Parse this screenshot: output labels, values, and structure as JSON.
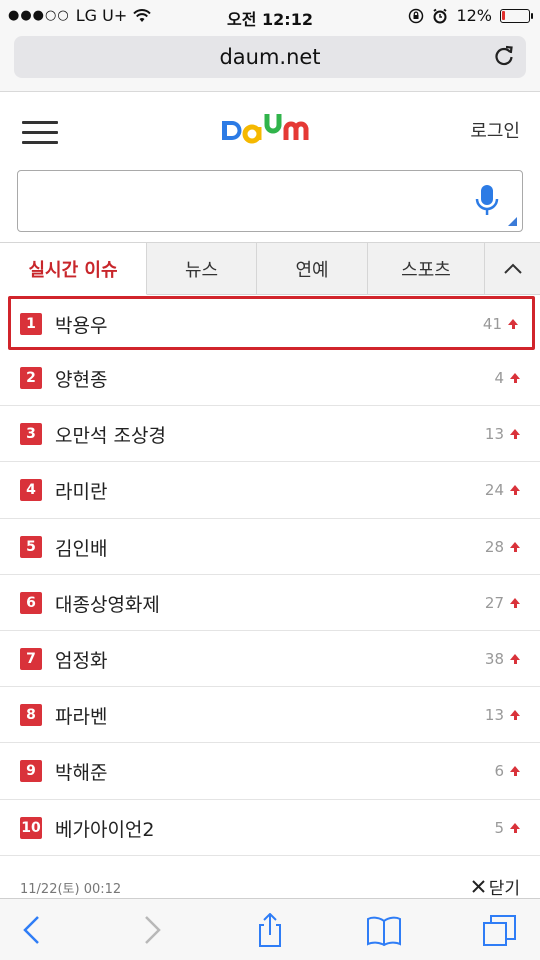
{
  "status_bar": {
    "signal": "●●●○○",
    "carrier": "LG U+",
    "time": "오전 12:12",
    "battery": "12%",
    "battery_level": 0.12,
    "battery_color": "#e0302e"
  },
  "browser": {
    "url": "daum.net"
  },
  "header": {
    "login_label": "로그인"
  },
  "search": {
    "value": "",
    "placeholder": ""
  },
  "tabs": [
    {
      "label": "실시간 이슈",
      "active": true
    },
    {
      "label": "뉴스"
    },
    {
      "label": "연예"
    },
    {
      "label": "스포츠"
    }
  ],
  "trending": [
    {
      "rank": "1",
      "keyword": "박용우",
      "change": "41"
    },
    {
      "rank": "2",
      "keyword": "양현종",
      "change": "4"
    },
    {
      "rank": "3",
      "keyword": "오만석 조상경",
      "change": "13"
    },
    {
      "rank": "4",
      "keyword": "라미란",
      "change": "24"
    },
    {
      "rank": "5",
      "keyword": "김인배",
      "change": "28"
    },
    {
      "rank": "6",
      "keyword": "대종상영화제",
      "change": "27"
    },
    {
      "rank": "7",
      "keyword": "엄정화",
      "change": "38"
    },
    {
      "rank": "8",
      "keyword": "파라벤",
      "change": "13"
    },
    {
      "rank": "9",
      "keyword": "박해준",
      "change": "6"
    },
    {
      "rank": "10",
      "keyword": "베가아이언2",
      "change": "5"
    }
  ],
  "footer": {
    "timestamp": "11/22(토) 00:12",
    "close_label": "닫기"
  },
  "colors": {
    "accent": "#d9323a",
    "link_blue": "#3b7bd8",
    "daum_blue": "#2c7be5",
    "daum_yellow": "#f5b800",
    "daum_green": "#31b44b",
    "daum_red": "#e53935"
  }
}
